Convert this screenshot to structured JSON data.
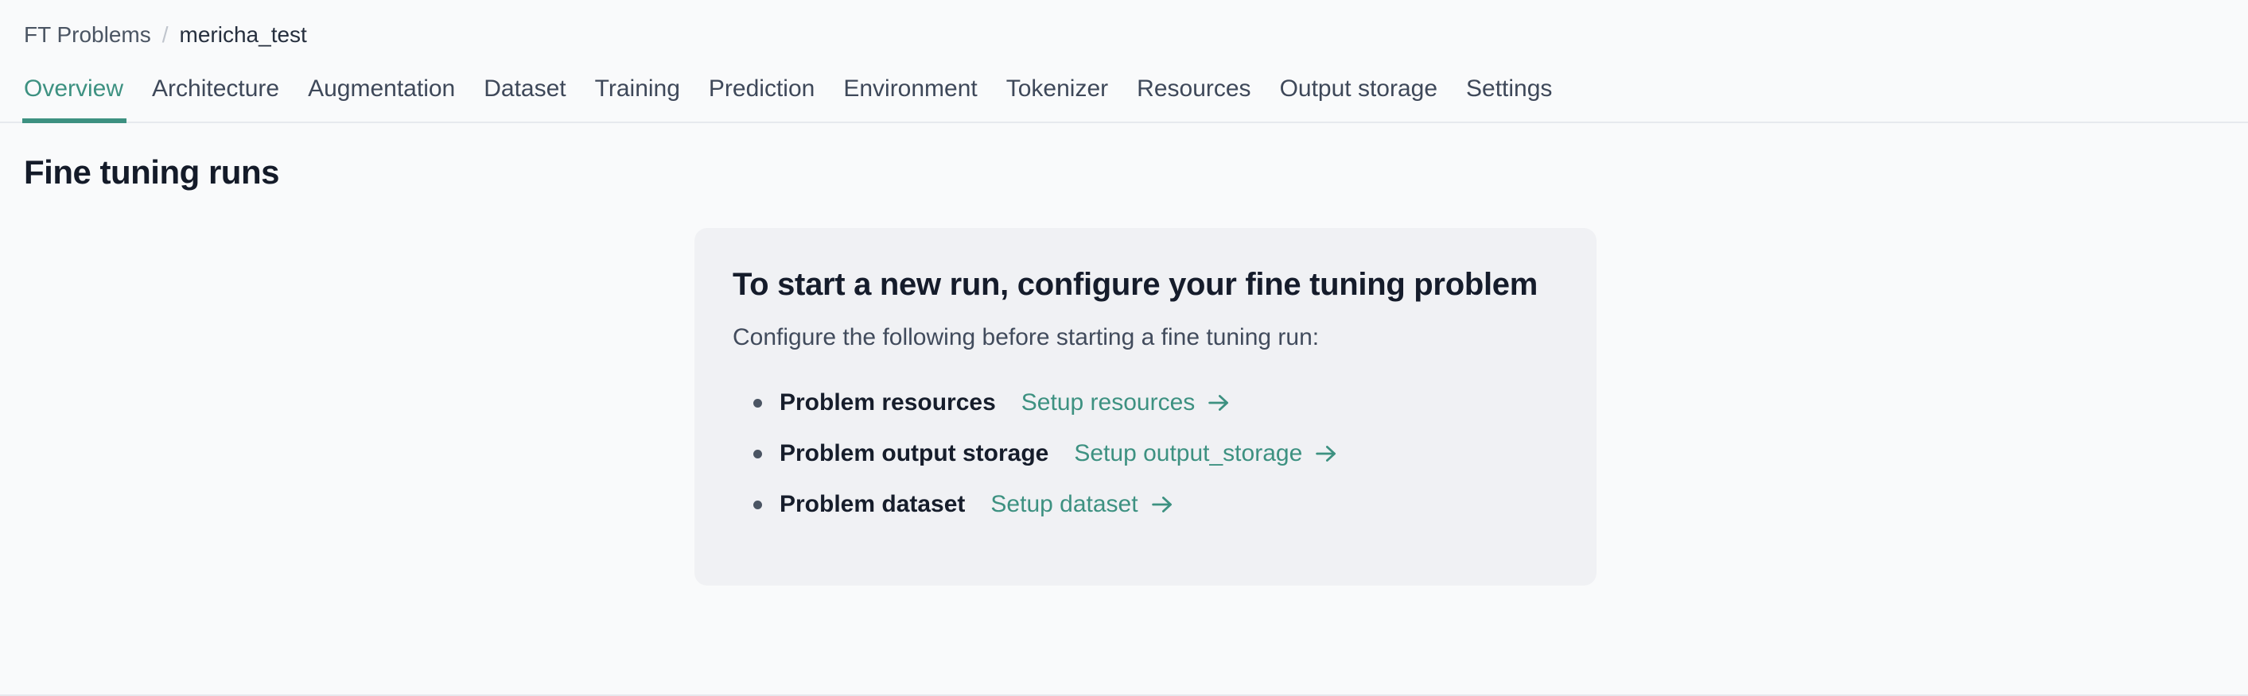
{
  "breadcrumb": {
    "separator": "/",
    "root": "FT Problems",
    "current": "mericha_test"
  },
  "tabs": [
    {
      "label": "Overview",
      "active": true
    },
    {
      "label": "Architecture",
      "active": false
    },
    {
      "label": "Augmentation",
      "active": false
    },
    {
      "label": "Dataset",
      "active": false
    },
    {
      "label": "Training",
      "active": false
    },
    {
      "label": "Prediction",
      "active": false
    },
    {
      "label": "Environment",
      "active": false
    },
    {
      "label": "Tokenizer",
      "active": false
    },
    {
      "label": "Resources",
      "active": false
    },
    {
      "label": "Output storage",
      "active": false
    },
    {
      "label": "Settings",
      "active": false
    }
  ],
  "page": {
    "title": "Fine tuning runs"
  },
  "card": {
    "title": "To start a new run, configure your fine tuning problem",
    "subtitle": "Configure the following before starting a fine tuning run:",
    "items": [
      {
        "label": "Problem resources",
        "link": "Setup resources"
      },
      {
        "label": "Problem output storage",
        "link": "Setup output_storage"
      },
      {
        "label": "Problem dataset",
        "link": "Setup dataset"
      }
    ]
  },
  "colors": {
    "accent_teal": "#3d9181",
    "heading_navy": "#151c2b",
    "page_background": "#f9fafb",
    "card_background": "#f0f1f4"
  }
}
